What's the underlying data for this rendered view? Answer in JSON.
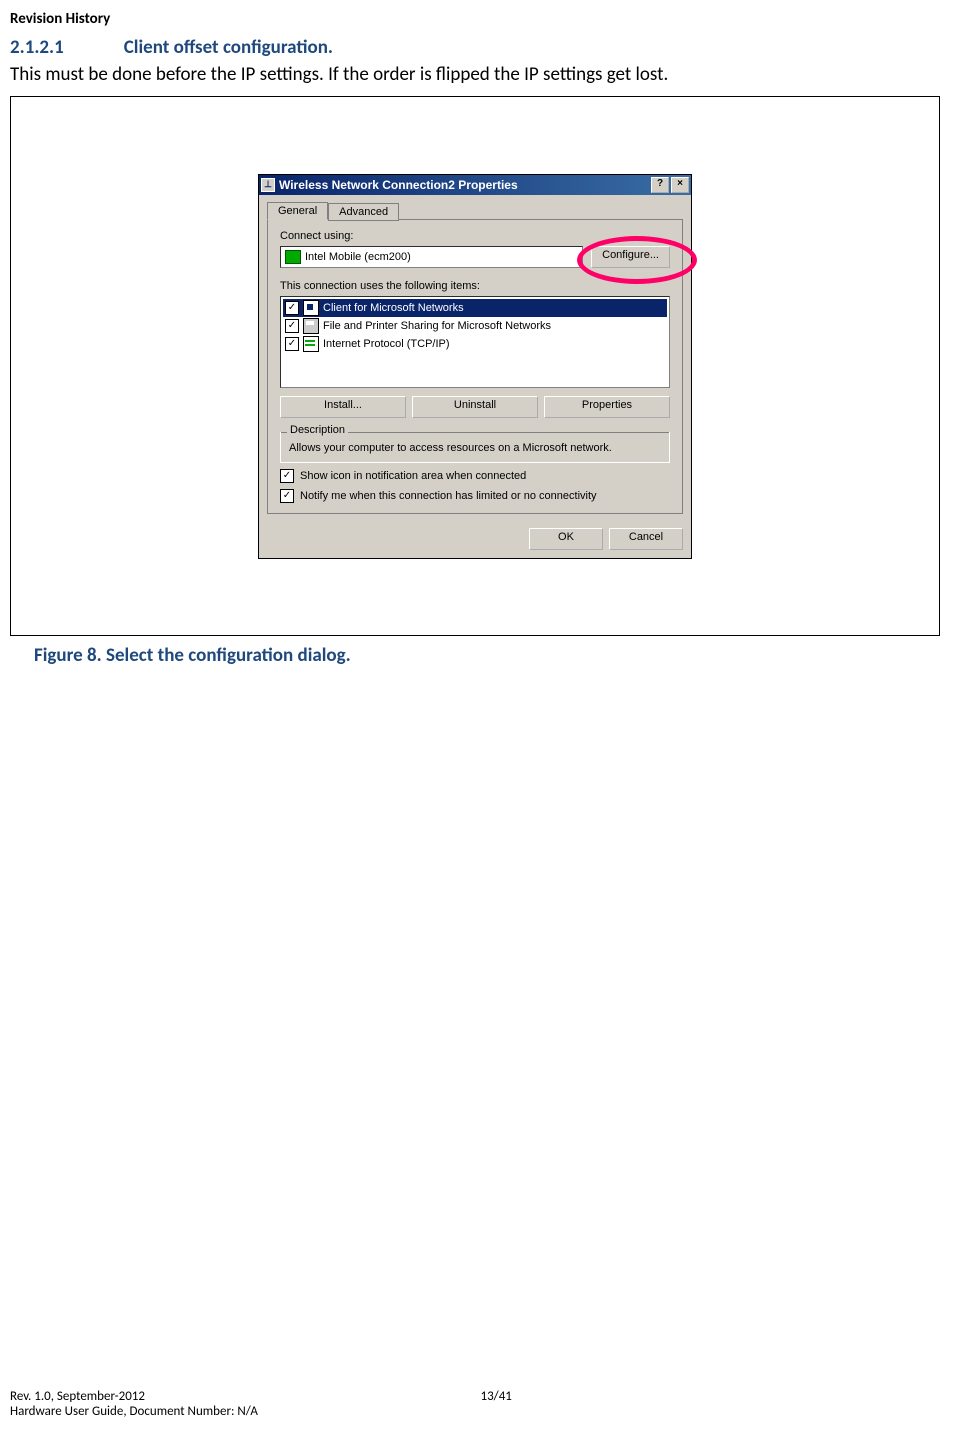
{
  "header": {
    "title": "Revision History"
  },
  "section": {
    "number": "2.1.2.1",
    "title": "Client offset configuration.",
    "body": "This must be done before the IP settings. If the order is flipped the IP settings get lost."
  },
  "dialog": {
    "title": "Wireless Network Connection2 Properties",
    "tabs": {
      "general": "General",
      "advanced": "Advanced"
    },
    "connect_label": "Connect using:",
    "device": "Intel Mobile (ecm200)",
    "configure_btn": "Configure...",
    "items_label": "This connection uses the following items:",
    "items": [
      {
        "label": "Client for Microsoft Networks"
      },
      {
        "label": "File and Printer Sharing for Microsoft Networks"
      },
      {
        "label": "Internet Protocol (TCP/IP)"
      }
    ],
    "buttons": {
      "install": "Install...",
      "uninstall": "Uninstall",
      "properties": "Properties"
    },
    "description_legend": "Description",
    "description_text": "Allows your computer to access resources on a Microsoft network.",
    "show_icon": "Show icon in notification area when connected",
    "notify": "Notify me when this connection has limited or no connectivity",
    "ok": "OK",
    "cancel": "Cancel"
  },
  "figure_caption": "Figure 8. Select the configuration dialog.",
  "footer": {
    "rev": "Rev. 1.0, September-2012",
    "page": "13/41",
    "doc": "Hardware User Guide, Document Number: N/A"
  }
}
